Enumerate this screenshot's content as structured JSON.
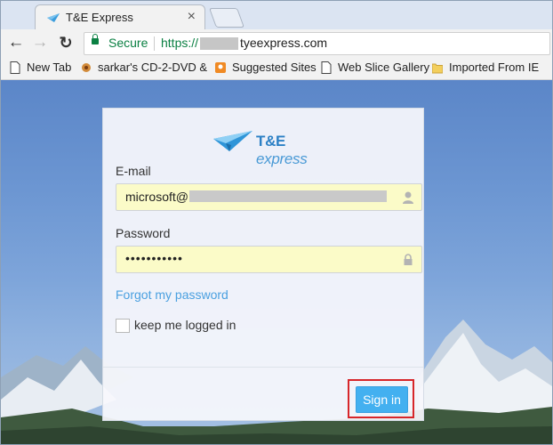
{
  "browser": {
    "tab_title": "T&E Express",
    "tab_close": "×",
    "secure_label": "Secure",
    "url_scheme": "https://",
    "url_host": "tyeexpress.com",
    "bookmarks": [
      {
        "label": "New Tab",
        "icon": "page-icon"
      },
      {
        "label": "sarkar's CD-2-DVD &",
        "icon": "site-icon"
      },
      {
        "label": "Suggested Sites",
        "icon": "suggested-icon"
      },
      {
        "label": "Web Slice Gallery",
        "icon": "page-icon"
      },
      {
        "label": "Imported From IE",
        "icon": "folder-icon"
      }
    ]
  },
  "login": {
    "logo_brand": "T&E",
    "logo_suffix": " express",
    "email_label": "E-mail",
    "email_value": "microsoft@",
    "password_label": "Password",
    "password_value": "•••••••••••",
    "forgot_link": "Forgot my password",
    "keep_logged_in": "keep me logged in",
    "signin_label": "Sign in"
  },
  "colors": {
    "accent": "#43b0f0",
    "link": "#4aa0e0",
    "secure": "#0b8043",
    "highlight": "#d7262a"
  }
}
